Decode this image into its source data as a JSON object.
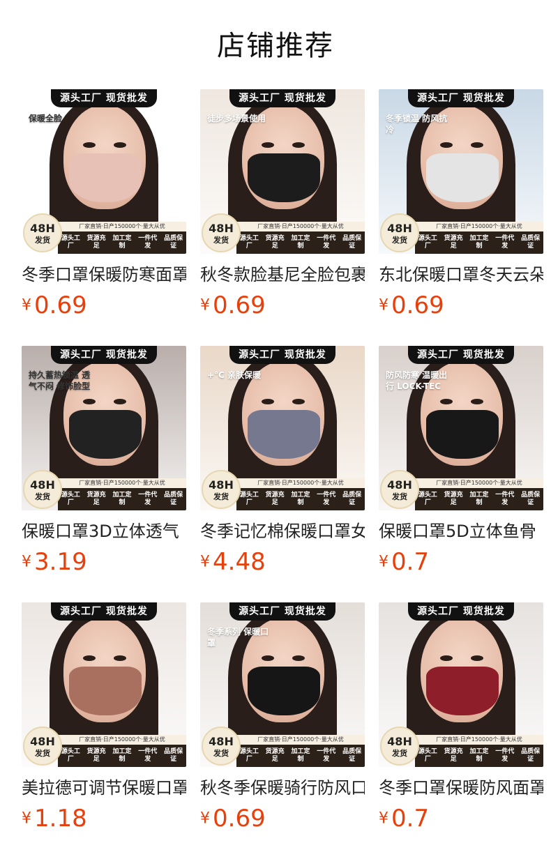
{
  "page_title": "店铺推荐",
  "banner_text": "源头工厂 现货批发",
  "factory_text": "厂家直销·日产150000个·量大从优",
  "badge": {
    "line1": "48H",
    "line2": "发货"
  },
  "tags": [
    "源头工厂",
    "货源充足",
    "加工定制",
    "一件代发",
    "品质保证"
  ],
  "currency": "¥",
  "products": [
    {
      "name": "冬季口罩保暖防寒面罩",
      "price": "0.69",
      "scene_color": "#ffffff",
      "mask_color": "#e8c1b6",
      "overlay": "保暖全脸"
    },
    {
      "name": "秋冬款脸基尼全脸包裹",
      "price": "0.69",
      "scene_color": "#efe7df",
      "mask_color": "#1c1c1c",
      "overlay": "徒步多场景使用"
    },
    {
      "name": "东北保暖口罩冬天云朵",
      "price": "0.69",
      "scene_color": "#c9d8e6",
      "mask_color": "#e4e4e4",
      "overlay": "冬季锁温 防风抗冷"
    },
    {
      "name": "保暖口罩3D立体透气",
      "price": "3.19",
      "scene_color": "#b9aeaa",
      "mask_color": "#222222",
      "overlay": "持久蓄热锁温 透气不闷 修饰脸型"
    },
    {
      "name": "冬季记忆棉保暖口罩女",
      "price": "4.48",
      "scene_color": "#e9d8c8",
      "mask_color": "#767890",
      "overlay": "+°C 亲肤保暖"
    },
    {
      "name": "保暖口罩5D立体鱼骨",
      "price": "0.7",
      "scene_color": "#d9d0cb",
      "mask_color": "#181818",
      "overlay": "防风防寒 温暖出行 LOCK-TEC"
    },
    {
      "name": "美拉德可调节保暖口罩",
      "price": "1.18",
      "scene_color": "#ece6e2",
      "mask_color": "#a96f5f",
      "overlay": ""
    },
    {
      "name": "秋冬季保暖骑行防风口罩",
      "price": "0.69",
      "scene_color": "#e4ded9",
      "mask_color": "#161616",
      "overlay": "冬季系列 保暖口罩"
    },
    {
      "name": "冬季口罩保暖防风面罩",
      "price": "0.7",
      "scene_color": "#e6e2e0",
      "mask_color": "#8e1f2a",
      "overlay": ""
    }
  ]
}
